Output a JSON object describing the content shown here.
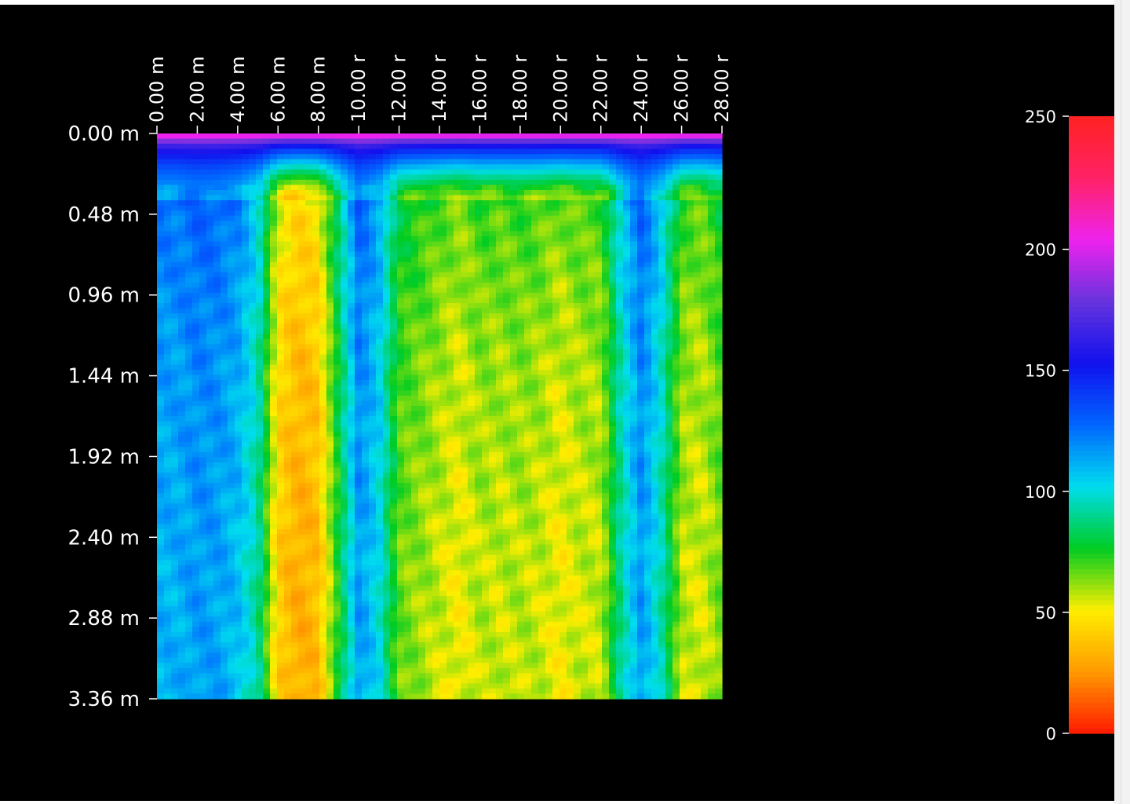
{
  "chart_data": {
    "type": "heatmap",
    "title": "",
    "xlabel": "",
    "ylabel": "",
    "x_ticks": [
      "0.00 m",
      "2.00 m",
      "4.00 m",
      "6.00 m",
      "8.00 m",
      "10.00 r",
      "12.00 r",
      "14.00 r",
      "16.00 r",
      "18.00 r",
      "20.00 r",
      "22.00 r",
      "24.00 r",
      "26.00 r",
      "28.00 r"
    ],
    "x_tick_values": [
      0,
      2,
      4,
      6,
      8,
      10,
      12,
      14,
      16,
      18,
      20,
      22,
      24,
      26,
      28
    ],
    "xlim": [
      0,
      28
    ],
    "x_axis_position": "top",
    "y_ticks": [
      "0.00 m",
      "0.48 m",
      "0.96 m",
      "1.44 m",
      "1.92 m",
      "2.40 m",
      "2.88 m",
      "3.36 m"
    ],
    "y_tick_values": [
      0,
      0.48,
      0.96,
      1.44,
      1.92,
      2.4,
      2.88,
      3.36
    ],
    "ylim": [
      0,
      3.36
    ],
    "y_inverted": true,
    "colorbar": {
      "ticks": [
        "0",
        "50",
        "100",
        "150",
        "200",
        "250"
      ],
      "tick_values": [
        0,
        50,
        100,
        150,
        200,
        255
      ],
      "range": [
        0,
        255
      ],
      "colors": [
        "#ff1a00",
        "#ff9900",
        "#ffee00",
        "#00cc22",
        "#00ddee",
        "#0066ff",
        "#1111ee",
        "#6633dd",
        "#ee22ee",
        "#ff2266",
        "#ff2222"
      ]
    },
    "grid": false,
    "legend": "none",
    "column_profile": {
      "x": [
        0,
        1,
        2,
        3,
        4,
        5,
        6,
        7,
        8,
        9,
        10,
        11,
        12,
        13,
        14,
        15,
        16,
        17,
        18,
        19,
        20,
        21,
        22,
        23,
        24,
        25,
        26,
        27,
        28
      ],
      "values": [
        115,
        115,
        120,
        118,
        112,
        95,
        45,
        35,
        40,
        80,
        120,
        105,
        70,
        65,
        60,
        55,
        62,
        60,
        62,
        60,
        55,
        60,
        60,
        95,
        120,
        98,
        62,
        58,
        70
      ]
    },
    "depth_profile": {
      "y": [
        0,
        0.08,
        0.2,
        0.48,
        0.96,
        1.44,
        1.92,
        2.4,
        2.88,
        3.36
      ],
      "values": [
        215,
        175,
        155,
        110,
        90,
        75,
        70,
        62,
        60,
        60
      ]
    }
  },
  "colors": {
    "background": "#000000",
    "text": "#ffffff",
    "page": "#ffffff"
  }
}
